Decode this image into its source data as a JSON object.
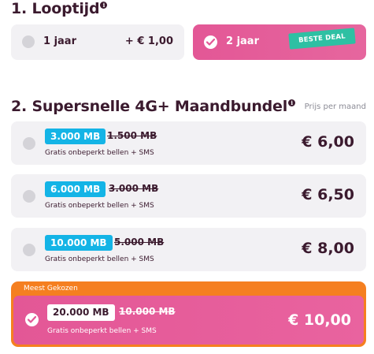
{
  "term": {
    "title": "1. Looptijd",
    "info_icon": "info-icon",
    "options": [
      {
        "label": "1 jaar",
        "price": "+ € 1,00",
        "selected": false
      },
      {
        "label": "2 jaar",
        "badge": "BESTE DEAL",
        "selected": true
      }
    ]
  },
  "bundles": {
    "title": "2. Supersnelle 4G+ Maandbundel",
    "note": "Prijs per maand",
    "items": [
      {
        "mb": "3.000 MB",
        "old_mb": "1.500 MB",
        "sub": "Gratis onbeperkt bellen + SMS",
        "price": "€ 6,00",
        "selected": false
      },
      {
        "mb": "6.000 MB",
        "old_mb": "3.000 MB",
        "sub": "Gratis onbeperkt bellen + SMS",
        "price": "€ 6,50",
        "selected": false
      },
      {
        "mb": "10.000 MB",
        "old_mb": "5.000 MB",
        "sub": "Gratis onbeperkt bellen + SMS",
        "price": "€ 8,00",
        "selected": false
      }
    ],
    "featured": {
      "ribbon": "Meest Gekozen",
      "mb": "20.000 MB",
      "old_mb": "10.000 MB",
      "sub": "Gratis onbeperkt bellen + SMS",
      "price": "€ 10,00",
      "selected": true
    }
  },
  "colors": {
    "pink": "#e35796",
    "orange": "#f57f20",
    "blue": "#14b4e6",
    "teal": "#2ec0a3",
    "dark": "#3b1a2e",
    "card_bg": "#f2f1f4"
  }
}
